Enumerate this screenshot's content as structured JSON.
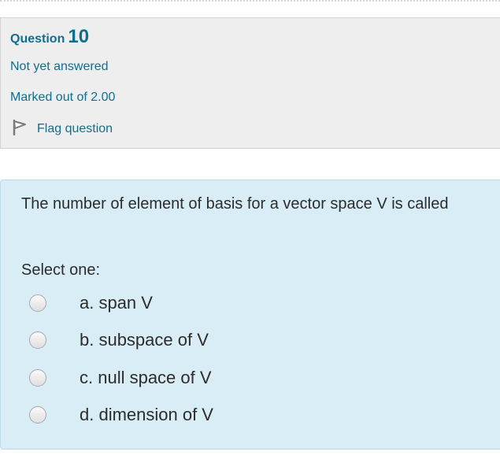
{
  "question_info": {
    "question_word": "Question",
    "question_number": "10",
    "state": "Not yet answered",
    "grade": "Marked out of 2.00",
    "flag_label": "Flag question",
    "flag_icon": "flag-icon"
  },
  "question": {
    "text": "The number of  element of basis for a vector space V is called",
    "prompt": "Select one:",
    "options": [
      {
        "label": "a. span V",
        "selected": false
      },
      {
        "label": "b. subspace of V",
        "selected": false
      },
      {
        "label": "c. null space of V",
        "selected": false
      },
      {
        "label": "d. dimension of V",
        "selected": false
      }
    ]
  },
  "colors": {
    "accent": "#0f6f8e",
    "info_background": "#eeeeee",
    "content_background": "#d9edf6",
    "text": "#2c2c2c"
  }
}
